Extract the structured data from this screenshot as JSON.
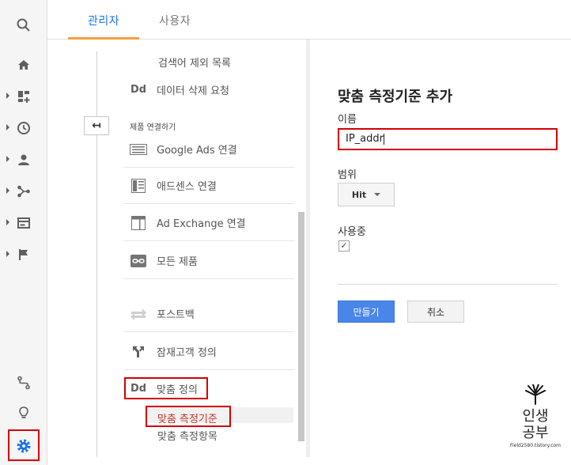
{
  "tabs": {
    "admin": "관리자",
    "user": "사용자"
  },
  "nav": {
    "filter_terms": "검색어 제외 목록",
    "delete_request": "데이터 삭제 요청",
    "section_product_linking": "제품 연결하기",
    "google_ads": "Google Ads 연결",
    "adsense": "애드센스 연결",
    "ad_exchange": "Ad Exchange 연결",
    "all_products": "모든 제품",
    "postback": "포스트백",
    "audience": "잠재고객 정의",
    "custom_definitions": "맞춤 정의",
    "custom_metrics": "맞춤 측정기준",
    "custom_metrics_items": "맞춤 측정항목"
  },
  "form": {
    "title": "맞춤 측정기준 추가",
    "name_label": "이름",
    "name_value": "IP_addr",
    "scope_label": "범위",
    "scope_value": "Hit",
    "active_label": "사용중",
    "active_checked": "✓",
    "create_button": "만들기",
    "cancel_button": "취소"
  },
  "watermark": {
    "line1": "인생",
    "line2": "공부",
    "url": "Field2580.tistory.com"
  },
  "icons": {
    "badge_dd": "Dd",
    "collapse": "↤",
    "rail": [
      "search-icon",
      "home-icon",
      "customization-icon",
      "realtime-icon",
      "audience-icon",
      "acquisition-icon",
      "behavior-icon",
      "conversions-icon",
      "attribution-icon",
      "discover-icon",
      "admin-gear-icon"
    ]
  },
  "colors": {
    "accent": "#1a73e8",
    "highlight_red": "#d40000",
    "tab_underline": "#f4a13a",
    "primary_button": "#4a86e8"
  }
}
